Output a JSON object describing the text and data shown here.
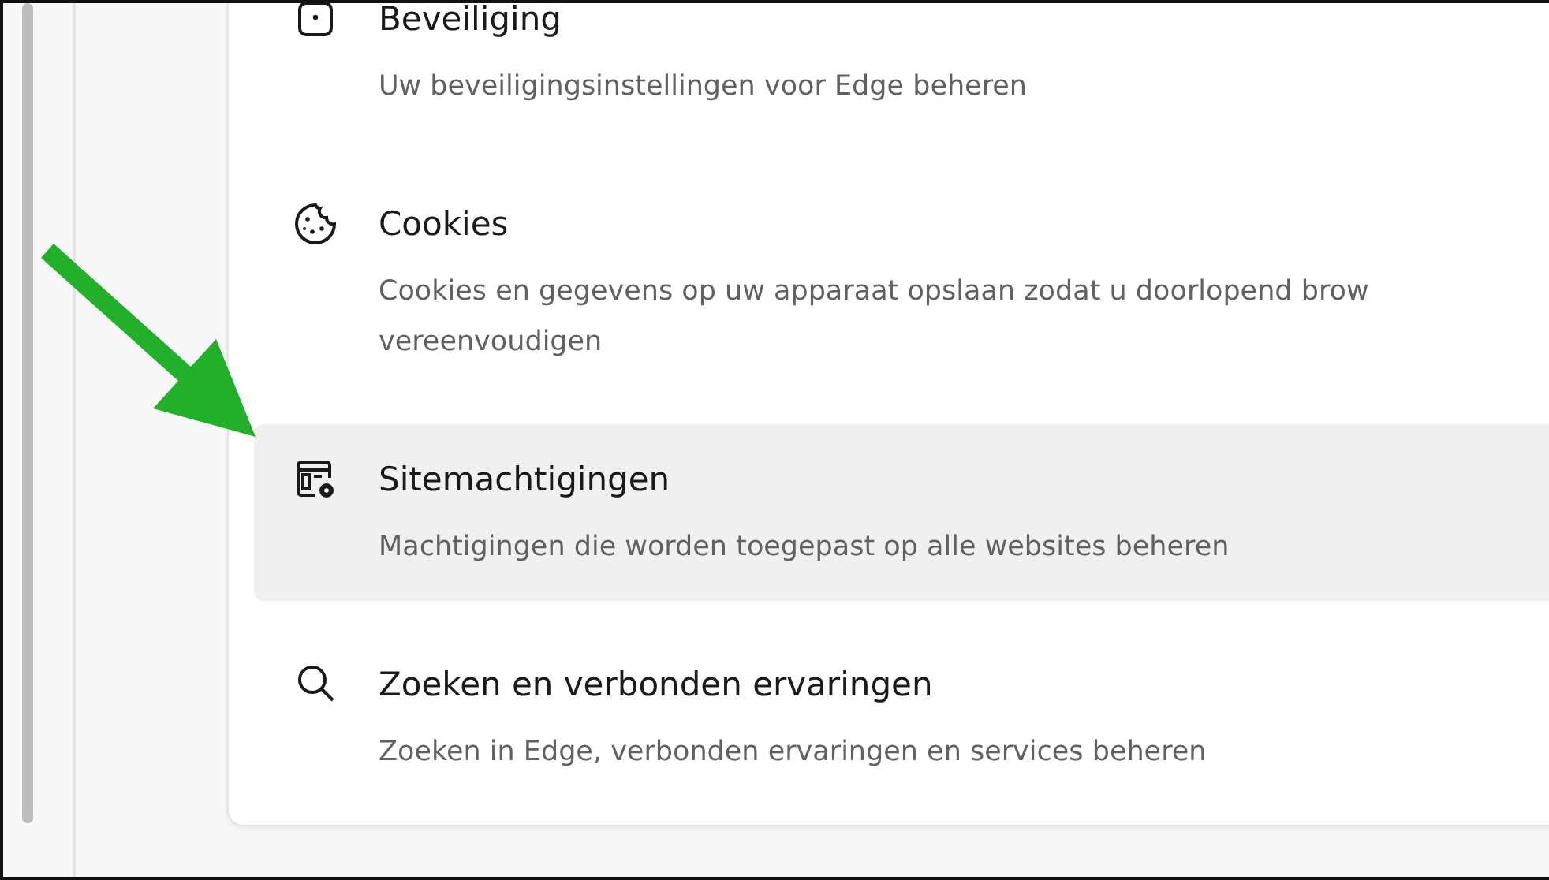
{
  "settings_items": [
    {
      "title": "Beveiliging",
      "description_lines": [
        "Uw beveiligingsinstellingen voor Edge beheren"
      ],
      "selected": false
    },
    {
      "title": "Cookies",
      "description_lines": [
        "Cookies en gegevens op uw apparaat opslaan zodat u doorlopend brow",
        "vereenvoudigen"
      ],
      "selected": false
    },
    {
      "title": "Sitemachtigingen",
      "description_lines": [
        "Machtigingen die worden toegepast op alle websites beheren"
      ],
      "selected": true
    },
    {
      "title": "Zoeken en verbonden ervaringen",
      "description_lines": [
        "Zoeken in Edge, verbonden ervaringen en services beheren"
      ],
      "selected": false
    }
  ]
}
